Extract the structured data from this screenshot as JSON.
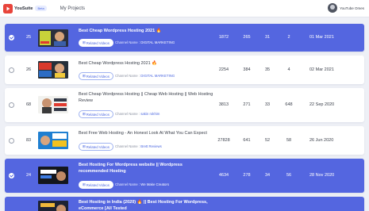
{
  "header": {
    "logo_text": "YouSuite",
    "beta_badge": "Beta",
    "nav_projects": "My Projects",
    "user_name": "YouTube Omes"
  },
  "colors": {
    "selected_row": "#5466e0",
    "accent": "#4a66e0"
  },
  "rows": [
    {
      "selected": true,
      "index": "25",
      "title": "Best Cheap Wordpress Hosting 2021 🔥",
      "related_label": "Related Videos",
      "channel_label": "Channel Name :",
      "channel_name": "DIGITAL MARKETING",
      "views": "1872",
      "likes": "265",
      "dislikes": "31",
      "comments": "2",
      "date": "01 Mar 2021"
    },
    {
      "selected": false,
      "index": "26",
      "title": "Best Cheap Wordpress Hosting 2021 🔥",
      "related_label": "Related Videos",
      "channel_label": "Channel Name :",
      "channel_name": "DIGITAL MARKETING",
      "views": "2254",
      "likes": "384",
      "dislikes": "35",
      "comments": "4",
      "date": "02 Mar 2021"
    },
    {
      "selected": false,
      "index": "68",
      "title": "Best Cheap Wordpress Hosting || Cheap Web Hosting || Web Hosting Review",
      "related_label": "Related Videos",
      "channel_label": "Channel Name :",
      "channel_name": "sakin rokhim",
      "views": "3813",
      "likes": "271",
      "dislikes": "33",
      "comments": "648",
      "date": "22 Sep 2020"
    },
    {
      "selected": false,
      "index": "83",
      "title": "Best Free Web Hosting - An Honest Look At What You Can Expect",
      "related_label": "Related Videos",
      "channel_label": "Channel Name :",
      "channel_name": "Brett Reviews",
      "views": "27828",
      "likes": "641",
      "dislikes": "52",
      "comments": "58",
      "date": "26 Jun 2020"
    },
    {
      "selected": true,
      "index": "24",
      "title": "Best Hosting For Wordpress website || Wordpress recommended Hosting",
      "related_label": "Related Videos",
      "channel_label": "Channel Name :",
      "channel_name": "We Make Creators",
      "views": "4634",
      "likes": "278",
      "dislikes": "34",
      "comments": "56",
      "date": "28 Nov 2020"
    },
    {
      "selected": true,
      "index": "",
      "title": "Best Hosting in India (2020) 🔥 || Best Hosting For Wordpress, eCommerce [All Tested",
      "related_label": "",
      "channel_label": "",
      "channel_name": "",
      "views": "",
      "likes": "",
      "dislikes": "",
      "comments": "",
      "date": ""
    }
  ]
}
